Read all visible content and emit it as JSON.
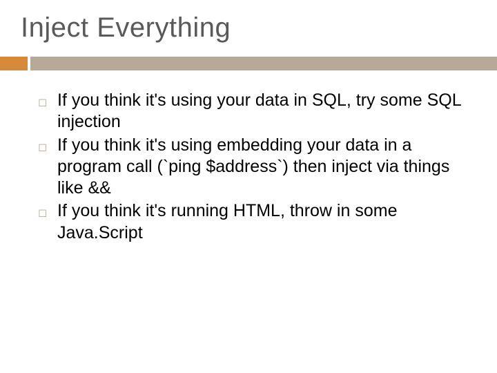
{
  "slide": {
    "title": "Inject Everything",
    "bullets": [
      "If you think it's using your data in SQL, try some SQL injection",
      "If you think it's using embedding your data in a program call (`ping $address`) then inject via things like &&",
      "If you think it's running HTML, throw in some Java.Script"
    ]
  }
}
